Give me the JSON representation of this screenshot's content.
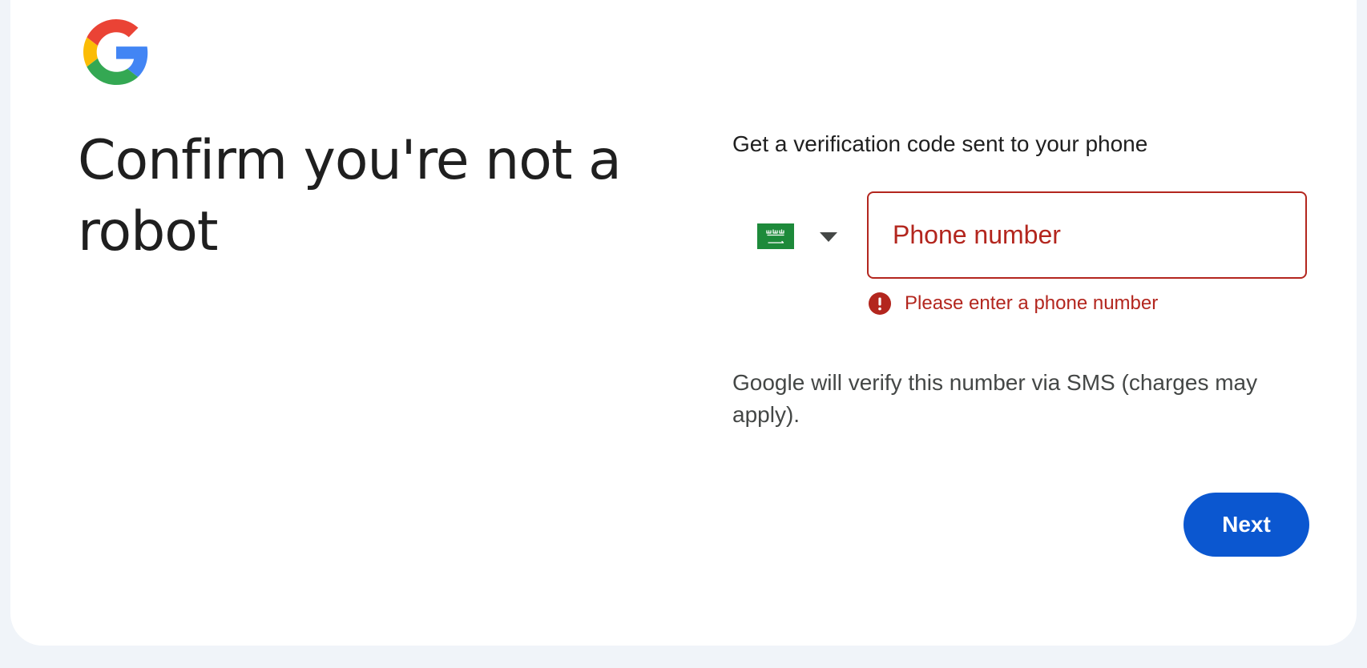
{
  "header": {
    "logo_icon": "google-g-logo-icon",
    "title": "Confirm you're not a robot"
  },
  "verification": {
    "subtitle": "Get a verification code sent to your phone",
    "country_select": {
      "selected_flag_icon": "saudi-arabia-flag-icon",
      "arrow_icon": "dropdown-arrow-icon"
    },
    "phone_input": {
      "value": "",
      "placeholder": "Phone number"
    },
    "error": {
      "icon": "error-icon",
      "message": "Please enter a phone number"
    },
    "sms_note": "Google will verify this number via SMS (charges may apply)."
  },
  "actions": {
    "next_label": "Next"
  },
  "colors": {
    "brand_blue": "#0b57d0",
    "error_red": "#b3261e",
    "text_primary": "#1f1f1f",
    "text_secondary": "#444746",
    "page_background": "#f0f4f9",
    "flag_green": "#1d8a3a"
  }
}
